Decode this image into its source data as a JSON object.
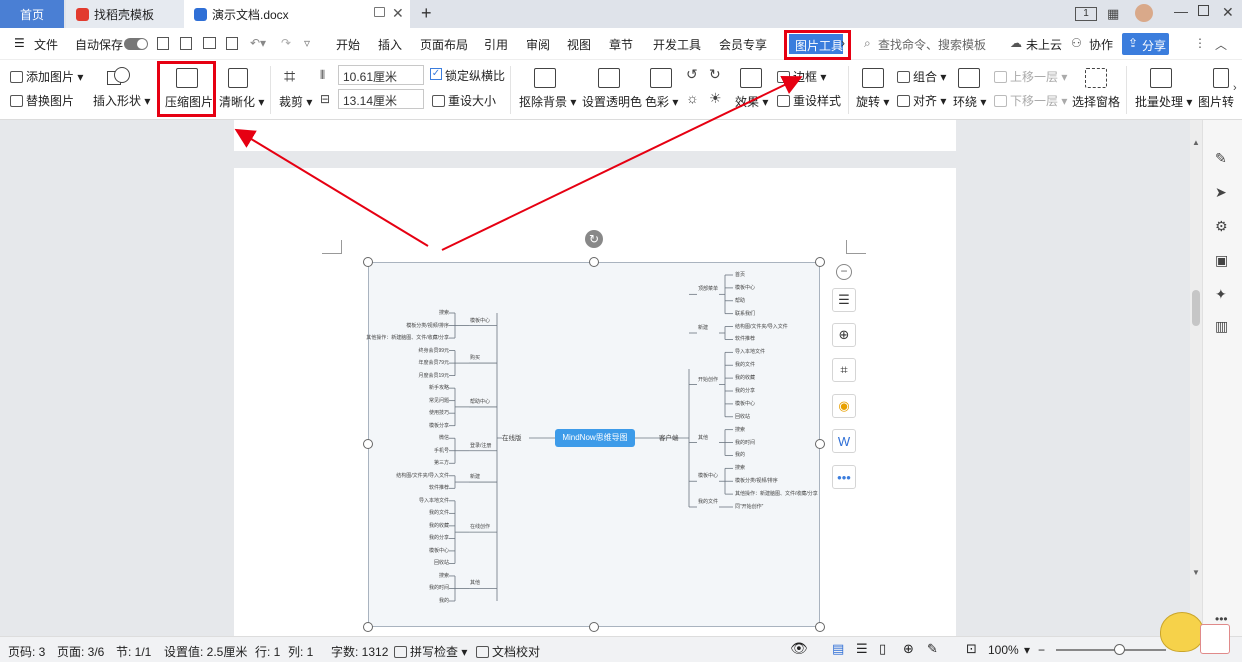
{
  "tabs": {
    "home": "首页",
    "zhaogao": "找稻壳模板",
    "doc": "演示文档.docx",
    "new_tab": "+"
  },
  "window": {
    "badge": "1"
  },
  "menu": {
    "file": "文件",
    "autosave": "自动保存",
    "items": [
      "开始",
      "插入",
      "页面布局",
      "引用",
      "审阅",
      "视图",
      "章节",
      "开发工具",
      "会员专享"
    ],
    "picture_tools": "图片工具",
    "search_placeholder": "查找命令、搜索模板",
    "cloud": "未上云",
    "collab": "协作",
    "share": "分享"
  },
  "ribbon": {
    "add_picture": "添加图片",
    "replace_picture": "替换图片",
    "insert_shape": "插入形状",
    "compress_picture": "压缩图片",
    "sharpen": "清晰化",
    "crop": "裁剪",
    "width": "10.61厘米",
    "height": "13.14厘米",
    "lock_ratio": "锁定纵横比",
    "reset_size": "重设大小",
    "remove_bg": "抠除背景",
    "set_transparent": "设置透明色",
    "color": "色彩",
    "effects": "效果",
    "border": "边框",
    "reset_style": "重设样式",
    "rotate": "旋转",
    "group": "组合",
    "align": "对齐",
    "wrap": "环绕",
    "bring_forward": "上移一层",
    "send_backward": "下移一层",
    "selection_pane": "选择窗格",
    "batch": "批量处理",
    "picture_convert": "图片转"
  },
  "mindmap": {
    "center": "MindNow思维导图",
    "left_main": "在线版",
    "right_main": "客户端",
    "left_groups": [
      {
        "label": "模板中心",
        "children": [
          "搜索",
          "模板分类/视频/排序",
          "其他操作：新建脑图、文件/收藏/分享"
        ]
      },
      {
        "label": "购买",
        "children": [
          "终身会员99元",
          "年度会员79元",
          "月度会员19元"
        ]
      },
      {
        "label": "帮助中心",
        "children": [
          "新手攻略",
          "常见问题",
          "使用技巧",
          "模板分享"
        ]
      },
      {
        "label": "登录/注册",
        "children": [
          "微信",
          "手机号",
          "第三方"
        ]
      },
      {
        "label": "新建",
        "children": [
          "结构图/文件夹/导入文件",
          "软件推荐"
        ]
      },
      {
        "label": "在线创作",
        "children": [
          "导入本地文件",
          "我的文件",
          "我的收藏",
          "我的分享",
          "模板中心",
          "回收站"
        ]
      },
      {
        "label": "其他",
        "children": [
          "搜索",
          "我的时间",
          "我的"
        ]
      }
    ],
    "right_groups": [
      {
        "label": "顶部菜单",
        "children": [
          "首页",
          "模板中心",
          "帮助",
          "联系我们"
        ]
      },
      {
        "label": "新建",
        "children": [
          "结构图/文件夹/导入文件",
          "软件推荐"
        ]
      },
      {
        "label": "开始创作",
        "children": [
          "导入本地文件",
          "我的文件",
          "我的收藏",
          "我的分享",
          "模板中心",
          "回收站"
        ]
      },
      {
        "label": "其他",
        "children": [
          "搜索",
          "我的时间",
          "我的"
        ]
      },
      {
        "label": "模板中心",
        "children": [
          "搜索",
          "模板分类/视频/排序",
          "其他操作：新建脑图、文件/收藏/分享"
        ]
      },
      {
        "label": "我的文件",
        "children": [
          "同“开始创作”"
        ]
      }
    ]
  },
  "status": {
    "page_code": "页码: 3",
    "page": "页面: 3/6",
    "section": "节: 1/1",
    "setting": "设置值: 2.5厘米",
    "row": "行: 1",
    "col": "列: 1",
    "words": "字数: 1312",
    "spell": "拼写检查",
    "proof": "文档校对",
    "zoom": "100%"
  },
  "colors": {
    "accent": "#4a7fd4",
    "highlight": "#e60012",
    "mind_center": "#3d9be9"
  }
}
